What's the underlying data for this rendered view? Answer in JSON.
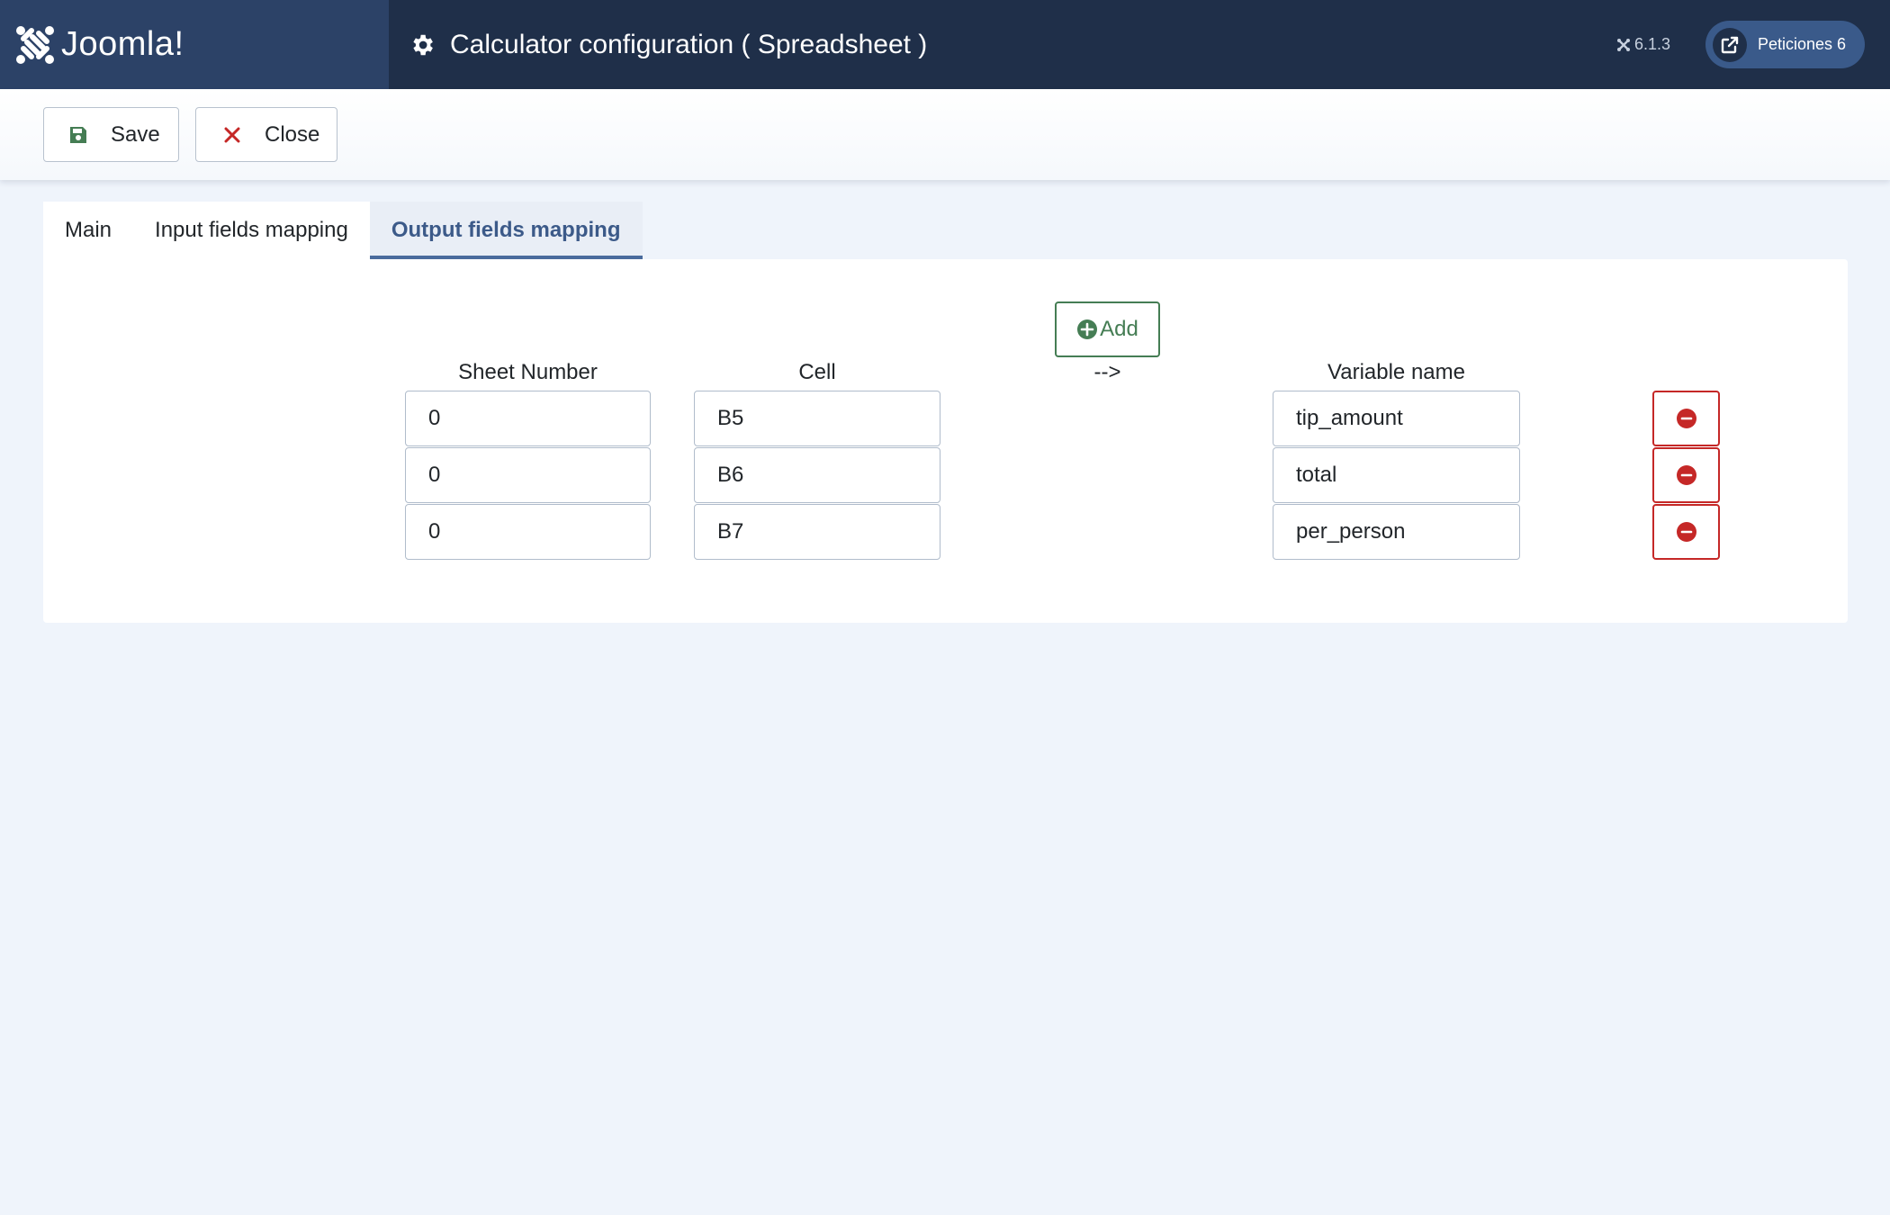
{
  "header": {
    "logo_text": "Joomla!",
    "title": "Calculator configuration ( Spreadsheet )",
    "version": "6.1.3",
    "requests_label": "Peticiones 6"
  },
  "toolbar": {
    "save_label": "Save",
    "close_label": "Close"
  },
  "tabs": [
    {
      "label": "Main",
      "active": false
    },
    {
      "label": "Input fields mapping",
      "active": false
    },
    {
      "label": "Output fields mapping",
      "active": true
    }
  ],
  "mapping": {
    "add_label": "Add",
    "columns": {
      "sheet": "Sheet Number",
      "cell": "Cell",
      "arrow": "-->",
      "variable": "Variable name"
    },
    "rows": [
      {
        "sheet": "0",
        "cell": "B5",
        "variable": "tip_amount"
      },
      {
        "sheet": "0",
        "cell": "B6",
        "variable": "total"
      },
      {
        "sheet": "0",
        "cell": "B7",
        "variable": "per_person"
      }
    ]
  },
  "colors": {
    "header_bg": "#1f2f49",
    "logo_bg": "#2c4267",
    "accent_active_tab": "#3c5a89",
    "success": "#457d54",
    "danger": "#c52827",
    "page_bg": "#eff4fb"
  },
  "icons": {
    "logo": "joomla-logo-icon",
    "title": "gear-icon",
    "version": "joomla-small-icon",
    "requests": "external-link-icon",
    "save": "floppy-disk-icon",
    "close": "x-icon",
    "add": "plus-circle-icon",
    "remove": "minus-circle-icon"
  }
}
